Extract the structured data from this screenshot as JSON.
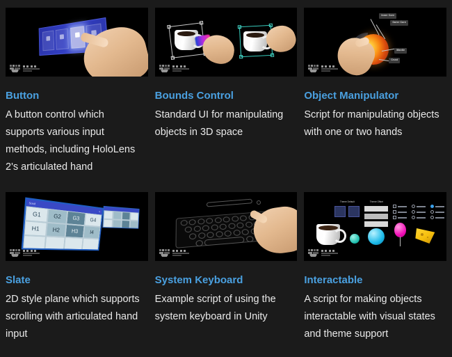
{
  "page": {
    "background": "#1b1b1b",
    "title_color": "#4aa0e0",
    "body_color": "#e9e9e9"
  },
  "watermark": {
    "brand": "MRTK"
  },
  "cards": [
    {
      "id": "button",
      "title": "Button",
      "description": "A button control which supports various input methods, including HoloLens 2's articulated hand",
      "thumbnail": "hand-pressing-holographic-button-panel"
    },
    {
      "id": "bounds-control",
      "title": "Bounds Control",
      "description": "Standard UI for manipulating objects in 3D space",
      "thumbnail": "two-hands-manipulating-mugs-with-bounding-boxes"
    },
    {
      "id": "object-manipulator",
      "title": "Object Manipulator",
      "description": "Script for manipulating objects with one or two hands",
      "thumbnail": "hand-holding-earth-cutaway-globe",
      "labels": [
        "Inner Core",
        "Outer Core",
        "Mantle",
        "Crust"
      ]
    },
    {
      "id": "slate",
      "title": "Slate",
      "description": "2D style plane which supports scrolling with articulated hand input",
      "thumbnail": "two-floating-2d-slate-panels-with-grid",
      "grid_cells": [
        "G1",
        "G2",
        "G3",
        "G4",
        "H1",
        "H2",
        "H3",
        "I4"
      ]
    },
    {
      "id": "system-keyboard",
      "title": "System Keyboard",
      "description": "Example script of using the system keyboard in Unity",
      "thumbnail": "hand-typing-on-holographic-keyboard"
    },
    {
      "id": "interactable",
      "title": "Interactable",
      "description": "A script for making objects interactable with visual states and theme support",
      "thumbnail": "mug-spheres-balloon-cheese-with-ui-panels",
      "panel_labels": [
        "Theme Default",
        "Theme Offset"
      ]
    }
  ]
}
